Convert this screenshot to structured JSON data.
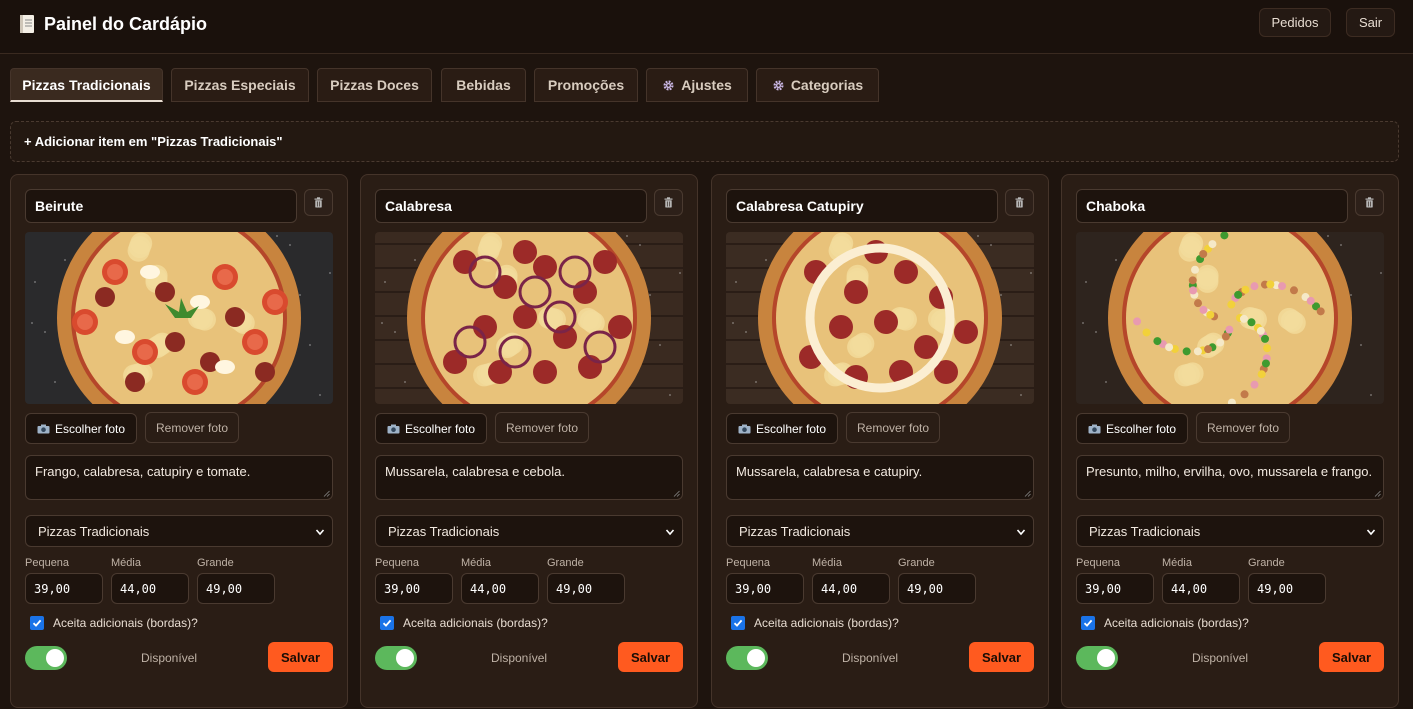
{
  "header": {
    "title": "Painel do Cardápio",
    "orders_label": "Pedidos",
    "logout_label": "Sair"
  },
  "tabs": [
    {
      "label": "Pizzas Tradicionais",
      "active": true
    },
    {
      "label": "Pizzas Especiais"
    },
    {
      "label": "Pizzas Doces"
    },
    {
      "label": "Bebidas"
    },
    {
      "label": "Promoções"
    },
    {
      "label": "Ajustes",
      "icon": "gear-icon"
    },
    {
      "label": "Categorias",
      "icon": "gear-icon"
    }
  ],
  "add_item_label": "+ Adicionar item em \"Pizzas Tradicionais\"",
  "labels": {
    "choose_photo": "Escolher foto",
    "remove_photo": "Remover foto",
    "size_small": "Pequena",
    "size_medium": "Média",
    "size_large": "Grande",
    "accepts_addons": "Aceita adicionais (bordas)?",
    "available": "Disponível",
    "save": "Salvar"
  },
  "colors": {
    "accent": "#ff5a1f",
    "toggle_on": "#5cb85c",
    "checkbox": "#1a73e8"
  },
  "items": [
    {
      "name": "Beirute",
      "description": "Frango, calabresa, catupiry e tomate.",
      "category": "Pizzas Tradicionais",
      "price_small": "39,00",
      "price_medium": "44,00",
      "price_large": "49,00",
      "accepts_addons": true,
      "available": true
    },
    {
      "name": "Calabresa",
      "description": "Mussarela, calabresa e cebola.",
      "category": "Pizzas Tradicionais",
      "price_small": "39,00",
      "price_medium": "44,00",
      "price_large": "49,00",
      "accepts_addons": true,
      "available": true
    },
    {
      "name": "Calabresa Catupiry",
      "description": "Mussarela, calabresa e catupiry.",
      "category": "Pizzas Tradicionais",
      "price_small": "39,00",
      "price_medium": "44,00",
      "price_large": "49,00",
      "accepts_addons": true,
      "available": true
    },
    {
      "name": "Chaboka",
      "description": "Presunto, milho, ervilha, ovo, mussarela e frango.",
      "category": "Pizzas Tradicionais",
      "price_small": "39,00",
      "price_medium": "44,00",
      "price_large": "49,00",
      "accepts_addons": true,
      "available": true
    }
  ]
}
